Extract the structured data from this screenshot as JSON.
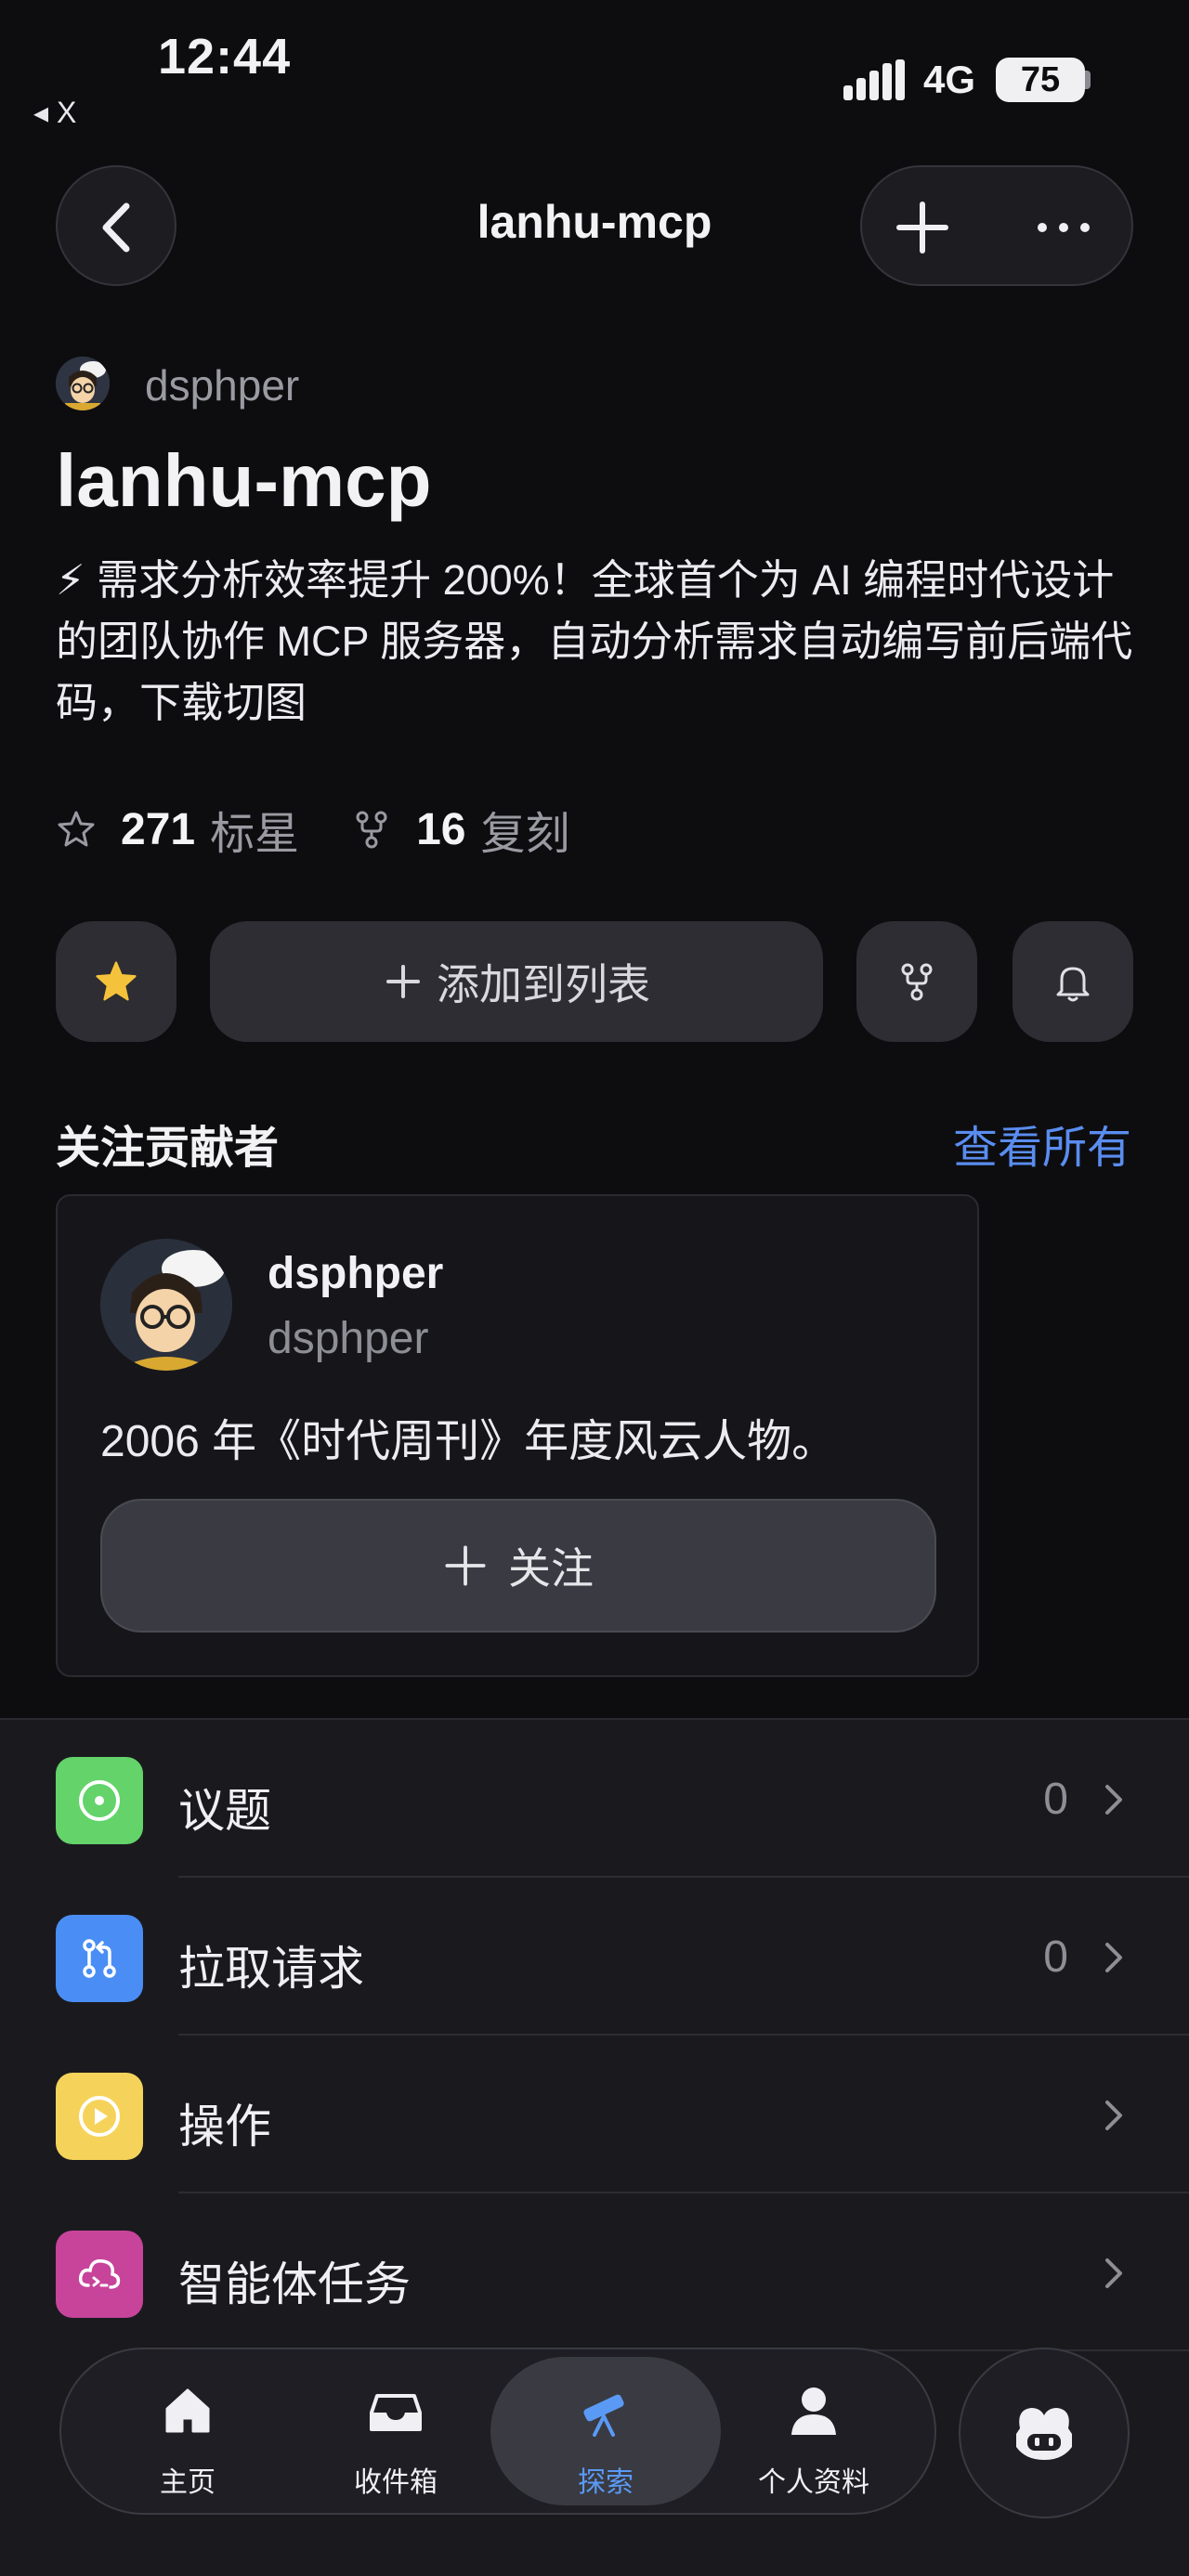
{
  "status_bar": {
    "time": "12:44",
    "back_app": "◂ X",
    "network": "4G",
    "battery": "75"
  },
  "nav": {
    "title": "lanhu-mcp"
  },
  "repo": {
    "owner": "dsphper",
    "name": "lanhu-mcp",
    "description": "⚡ 需求分析效率提升 200%！全球首个为 AI 编程时代设计的团队协作 MCP 服务器，自动分析需求自动编写前后端代码，下载切图",
    "stars_count": "271",
    "stars_label": "标星",
    "forks_count": "16",
    "forks_label": "复刻"
  },
  "actions": {
    "add_to_list": "添加到列表"
  },
  "contributors": {
    "title": "关注贡献者",
    "see_all": "查看所有",
    "card": {
      "name": "dsphper",
      "handle": "dsphper",
      "bio": "2006 年《时代周刊》年度风云人物。",
      "follow": "关注"
    }
  },
  "list": {
    "items": [
      {
        "label": "议题",
        "count": "0",
        "icon": "issue-icon",
        "color": "#63d36a"
      },
      {
        "label": "拉取请求",
        "count": "0",
        "icon": "pull-request-icon",
        "color": "#4a8ef5"
      },
      {
        "label": "操作",
        "count": "",
        "icon": "actions-play-icon",
        "color": "#f5d35a"
      },
      {
        "label": "智能体任务",
        "count": "",
        "icon": "agent-task-icon",
        "color": "#c7449a"
      }
    ]
  },
  "tabbar": {
    "tabs": [
      {
        "label": "主页",
        "icon": "home-icon"
      },
      {
        "label": "收件箱",
        "icon": "inbox-icon"
      },
      {
        "label": "探索",
        "icon": "telescope-icon",
        "active": true
      },
      {
        "label": "个人资料",
        "icon": "profile-icon"
      }
    ]
  },
  "colors": {
    "accent": "#5a8df0",
    "background": "#0d0d10",
    "star": "#f5c33b"
  }
}
